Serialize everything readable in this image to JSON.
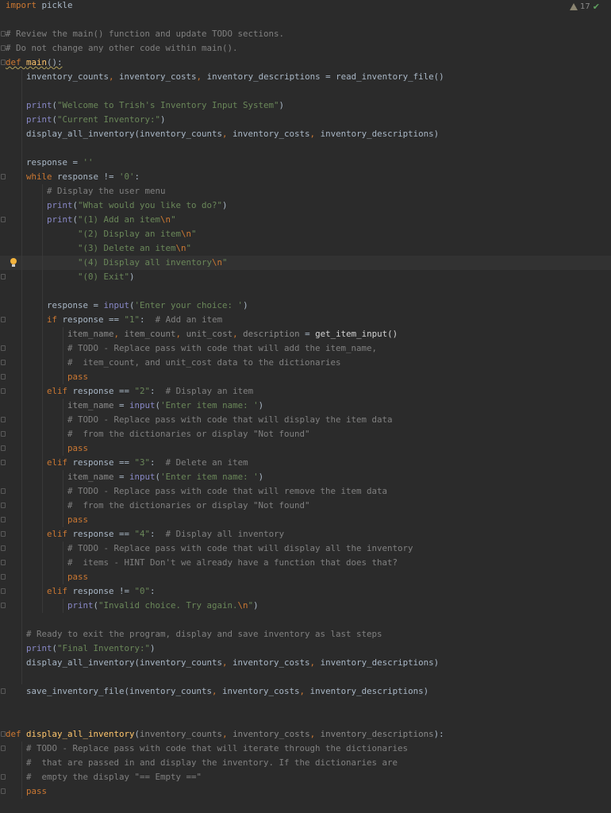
{
  "status": {
    "warning_count": "17",
    "check_icon": "check-icon"
  },
  "colors": {
    "background": "#2b2b2b",
    "keyword": "#cc7832",
    "string": "#6a8759",
    "comment": "#808080",
    "builtin": "#8888c6",
    "function": "#ffc66d"
  },
  "lines": [
    [
      [
        "k",
        "import"
      ],
      [
        "t",
        " pickle"
      ]
    ],
    [],
    [
      [
        "c",
        "# Review the main() function and update TODO sections."
      ]
    ],
    [
      [
        "c",
        "# Do not change any other code within main()."
      ]
    ],
    [
      [
        "k",
        "def "
      ],
      [
        "f",
        "main"
      ],
      [
        "t",
        "():"
      ]
    ],
    [
      [
        "t",
        "    inventory_counts"
      ],
      [
        "p",
        ", "
      ],
      [
        "t",
        "inventory_costs"
      ],
      [
        "p",
        ", "
      ],
      [
        "t",
        "inventory_descriptions = read_inventory_file()"
      ]
    ],
    [],
    [
      [
        "b",
        "    print"
      ],
      [
        "t",
        "("
      ],
      [
        "s",
        "\"Welcome to Trish's Inventory Input System\""
      ],
      [
        "t",
        ")"
      ]
    ],
    [
      [
        "b",
        "    print"
      ],
      [
        "t",
        "("
      ],
      [
        "s",
        "\"Current Inventory:\""
      ],
      [
        "t",
        ")"
      ]
    ],
    [
      [
        "t",
        "    display_all_inventory(inventory_counts"
      ],
      [
        "p",
        ", "
      ],
      [
        "t",
        "inventory_costs"
      ],
      [
        "p",
        ", "
      ],
      [
        "t",
        "inventory_descriptions)"
      ]
    ],
    [],
    [
      [
        "t",
        "    response = "
      ],
      [
        "s",
        "''"
      ]
    ],
    [
      [
        "k",
        "    while "
      ],
      [
        "t",
        "response != "
      ],
      [
        "s",
        "'0'"
      ],
      [
        "t",
        ":"
      ]
    ],
    [
      [
        "c",
        "        # Display the user menu"
      ]
    ],
    [
      [
        "b",
        "        print"
      ],
      [
        "t",
        "("
      ],
      [
        "s",
        "\"What would you like to do?\""
      ],
      [
        "t",
        ")"
      ]
    ],
    [
      [
        "b",
        "        print"
      ],
      [
        "t",
        "("
      ],
      [
        "s",
        "\"(1) Add an item"
      ],
      [
        "e",
        "\\n"
      ],
      [
        "s",
        "\""
      ]
    ],
    [
      [
        "s",
        "              \"(2) Display an item"
      ],
      [
        "e",
        "\\n"
      ],
      [
        "s",
        "\""
      ]
    ],
    [
      [
        "s",
        "              \"(3) Delete an item"
      ],
      [
        "e",
        "\\n"
      ],
      [
        "s",
        "\""
      ]
    ],
    [
      [
        "s",
        "              \"(4) Display all inventory"
      ],
      [
        "e",
        "\\n"
      ],
      [
        "s",
        "\""
      ]
    ],
    [
      [
        "s",
        "              \"(0) Exit\""
      ],
      [
        "t",
        ")"
      ]
    ],
    [],
    [
      [
        "t",
        "        response = "
      ],
      [
        "b",
        "input"
      ],
      [
        "t",
        "("
      ],
      [
        "s",
        "'Enter your choice: '"
      ],
      [
        "t",
        ")"
      ]
    ],
    [
      [
        "k",
        "        if "
      ],
      [
        "t",
        "response == "
      ],
      [
        "s",
        "\"1\""
      ],
      [
        "t",
        ":  "
      ],
      [
        "c",
        "# Add an item"
      ]
    ],
    [
      [
        "u",
        "            item_name"
      ],
      [
        "p",
        ", "
      ],
      [
        "u",
        "item_count"
      ],
      [
        "p",
        ", "
      ],
      [
        "u",
        "unit_cost"
      ],
      [
        "p",
        ", "
      ],
      [
        "u",
        "description"
      ],
      [
        "t",
        " = "
      ],
      [
        "w",
        "get_item_input()"
      ]
    ],
    [
      [
        "c",
        "            # TODO - Replace pass with code that will add the item_name,"
      ]
    ],
    [
      [
        "c",
        "            #  item_count, and unit_cost data to the dictionaries"
      ]
    ],
    [
      [
        "k",
        "            pass"
      ]
    ],
    [
      [
        "k",
        "        elif "
      ],
      [
        "t",
        "response == "
      ],
      [
        "s",
        "\"2\""
      ],
      [
        "t",
        ":  "
      ],
      [
        "c",
        "# Display an item"
      ]
    ],
    [
      [
        "u",
        "            item_name"
      ],
      [
        "t",
        " = "
      ],
      [
        "b",
        "input"
      ],
      [
        "t",
        "("
      ],
      [
        "s",
        "'Enter item name: '"
      ],
      [
        "t",
        ")"
      ]
    ],
    [
      [
        "c",
        "            # TODO - Replace pass with code that will display the item data"
      ]
    ],
    [
      [
        "c",
        "            #  from the dictionaries or display \"Not found\""
      ]
    ],
    [
      [
        "k",
        "            pass"
      ]
    ],
    [
      [
        "k",
        "        elif "
      ],
      [
        "t",
        "response == "
      ],
      [
        "s",
        "\"3\""
      ],
      [
        "t",
        ":  "
      ],
      [
        "c",
        "# Delete an item"
      ]
    ],
    [
      [
        "u",
        "            item_name"
      ],
      [
        "t",
        " = "
      ],
      [
        "b",
        "input"
      ],
      [
        "t",
        "("
      ],
      [
        "s",
        "'Enter item name: '"
      ],
      [
        "t",
        ")"
      ]
    ],
    [
      [
        "c",
        "            # TODO - Replace pass with code that will remove the item data"
      ]
    ],
    [
      [
        "c",
        "            #  from the dictionaries or display \"Not found\""
      ]
    ],
    [
      [
        "k",
        "            pass"
      ]
    ],
    [
      [
        "k",
        "        elif "
      ],
      [
        "t",
        "response == "
      ],
      [
        "s",
        "\"4\""
      ],
      [
        "t",
        ":  "
      ],
      [
        "c",
        "# Display all inventory"
      ]
    ],
    [
      [
        "c",
        "            # TODO - Replace pass with code that will display all the inventory"
      ]
    ],
    [
      [
        "c",
        "            #  items - HINT Don't we already have a function that does that?"
      ]
    ],
    [
      [
        "k",
        "            pass"
      ]
    ],
    [
      [
        "k",
        "        elif "
      ],
      [
        "t",
        "response != "
      ],
      [
        "s",
        "\"0\""
      ],
      [
        "t",
        ":"
      ]
    ],
    [
      [
        "b",
        "            print"
      ],
      [
        "t",
        "("
      ],
      [
        "s",
        "\"Invalid choice. Try again."
      ],
      [
        "e",
        "\\n"
      ],
      [
        "s",
        "\""
      ],
      [
        "t",
        ")"
      ]
    ],
    [],
    [
      [
        "c",
        "    # Ready to exit the program, display and save inventory as last steps"
      ]
    ],
    [
      [
        "b",
        "    print"
      ],
      [
        "t",
        "("
      ],
      [
        "s",
        "\"Final Inventory:\""
      ],
      [
        "t",
        ")"
      ]
    ],
    [
      [
        "t",
        "    display_all_inventory(inventory_counts"
      ],
      [
        "p",
        ", "
      ],
      [
        "t",
        "inventory_costs"
      ],
      [
        "p",
        ", "
      ],
      [
        "t",
        "inventory_descriptions)"
      ]
    ],
    [],
    [
      [
        "t",
        "    save_inventory_file(inventory_counts"
      ],
      [
        "p",
        ", "
      ],
      [
        "t",
        "inventory_costs"
      ],
      [
        "p",
        ", "
      ],
      [
        "t",
        "inventory_descriptions)"
      ]
    ],
    [],
    [],
    [
      [
        "k",
        "def "
      ],
      [
        "f",
        "display_all_inventory"
      ],
      [
        "t",
        "("
      ],
      [
        "u",
        "inventory_counts"
      ],
      [
        "p",
        ", "
      ],
      [
        "u",
        "inventory_costs"
      ],
      [
        "p",
        ", "
      ],
      [
        "u",
        "inventory_descriptions"
      ],
      [
        "t",
        "):"
      ]
    ],
    [
      [
        "c",
        "    # TODO - Replace pass with code that will iterate through the dictionaries"
      ]
    ],
    [
      [
        "c",
        "    #  that are passed in and display the inventory. If the dictionaries are"
      ]
    ],
    [
      [
        "c",
        "    #  empty the display \"== Empty ==\""
      ]
    ],
    [
      [
        "k",
        "    pass"
      ]
    ]
  ]
}
